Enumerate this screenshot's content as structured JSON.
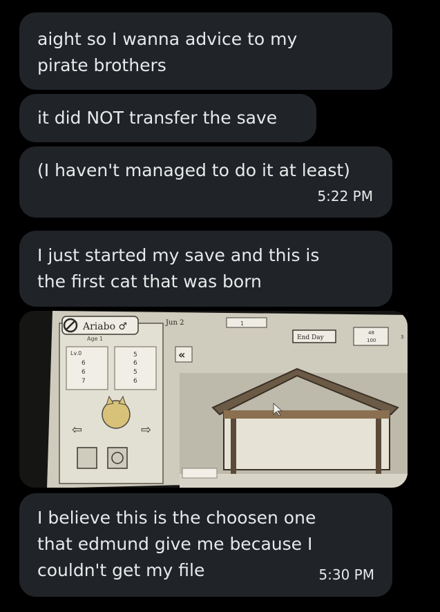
{
  "messages": [
    {
      "lines": [
        "aight so I wanna advice to my",
        "pirate brothers"
      ]
    },
    {
      "lines": [
        "it did NOT transfer the save"
      ]
    },
    {
      "lines": [
        "(I haven't managed to do it at least)"
      ],
      "time": "5:22 PM"
    },
    {
      "lines": [
        "I just started my save and this is",
        "the first cat that was born"
      ]
    },
    {
      "lines": [
        "I believe this is the choosen one",
        "that edmund give me because I",
        "couldn't get my file"
      ],
      "time": "5:30 PM"
    }
  ],
  "photo": {
    "cat_name": "Ariabo ♂",
    "age": "Age 1",
    "date": "Jun 2",
    "day_counter": "1",
    "end_day": "End Day",
    "food_top": "48",
    "food_bottom": "100",
    "food_count": "3",
    "level": "Lv.0",
    "stats_left": [
      "6",
      "6",
      "7"
    ],
    "stats_right": [
      "5",
      "6",
      "5",
      "6"
    ]
  },
  "colors": {
    "page_bg": "#000000",
    "bubble_bg": "#202327",
    "text": "#e7e9ea"
  }
}
